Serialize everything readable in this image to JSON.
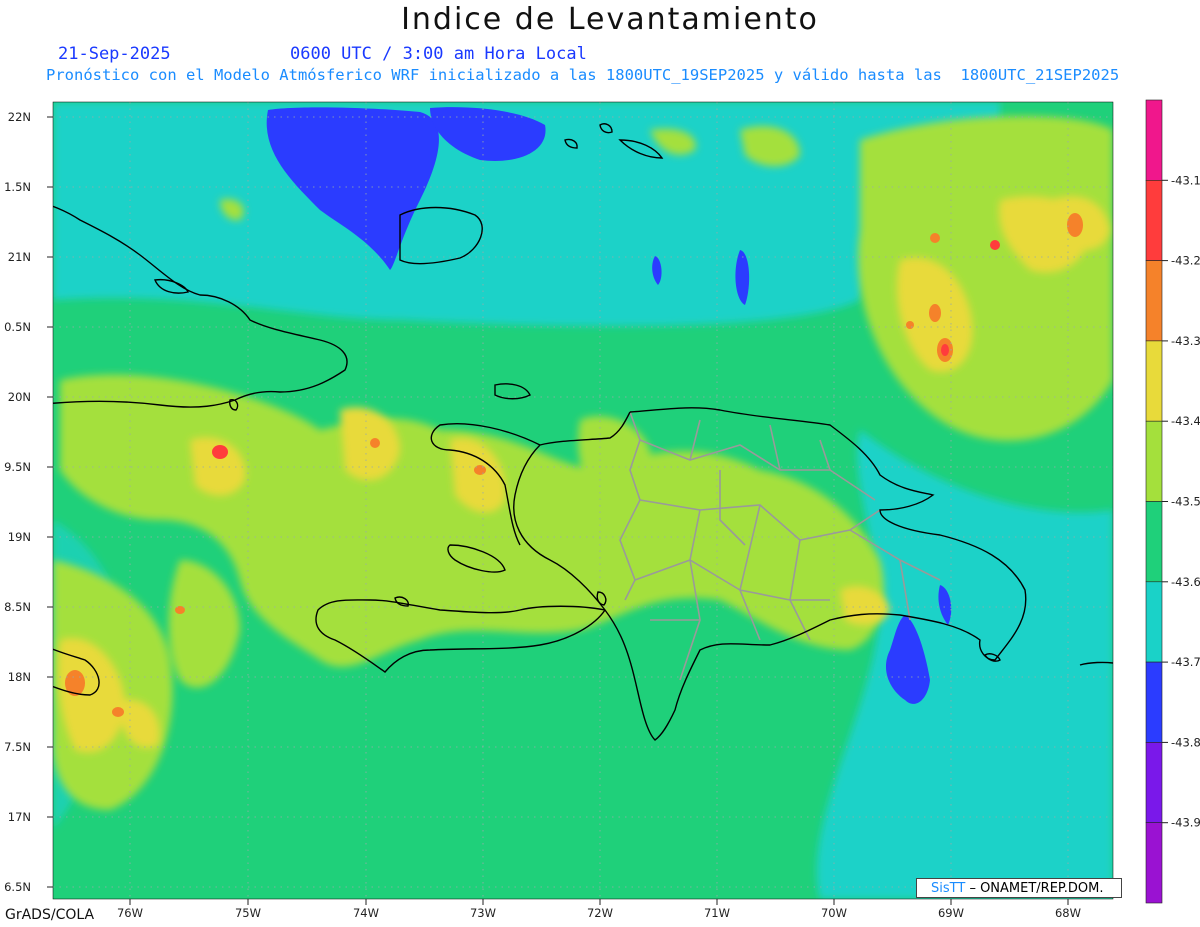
{
  "title": "Indice de Levantamiento",
  "date": "21-Sep-2025",
  "time_label": "0600 UTC / 3:00 am Hora Local",
  "description": "Pronóstico con el Modelo Atmósferico WRF inicializado a las 1800UTC_19SEP2025 y válido hasta las  1800UTC_21SEP2025",
  "lat_labels": [
    "22N",
    "1.5N",
    "21N",
    "0.5N",
    "20N",
    "9.5N",
    "19N",
    "8.5N",
    "18N",
    "7.5N",
    "17N",
    "6.5N"
  ],
  "lon_labels": [
    "76W",
    "75W",
    "74W",
    "73W",
    "72W",
    "71W",
    "70W",
    "69W",
    "68W"
  ],
  "colorbar": {
    "colors": [
      "#f0178c",
      "#ff3c3c",
      "#f5822a",
      "#e8da3a",
      "#a4e03c",
      "#1fd07a",
      "#1ad2c8",
      "#2b3cff",
      "#7a18ea",
      "#9a12d2"
    ],
    "labels": [
      "-43.1",
      "-43.2",
      "-43.3",
      "-43.4",
      "-43.5",
      "-43.6",
      "-43.7",
      "-43.8",
      "-43.9"
    ]
  },
  "credit": {
    "brand": "SisTT",
    "text": "– ONAMET/REP.DOM."
  },
  "footer": "GrADS/COLA"
}
